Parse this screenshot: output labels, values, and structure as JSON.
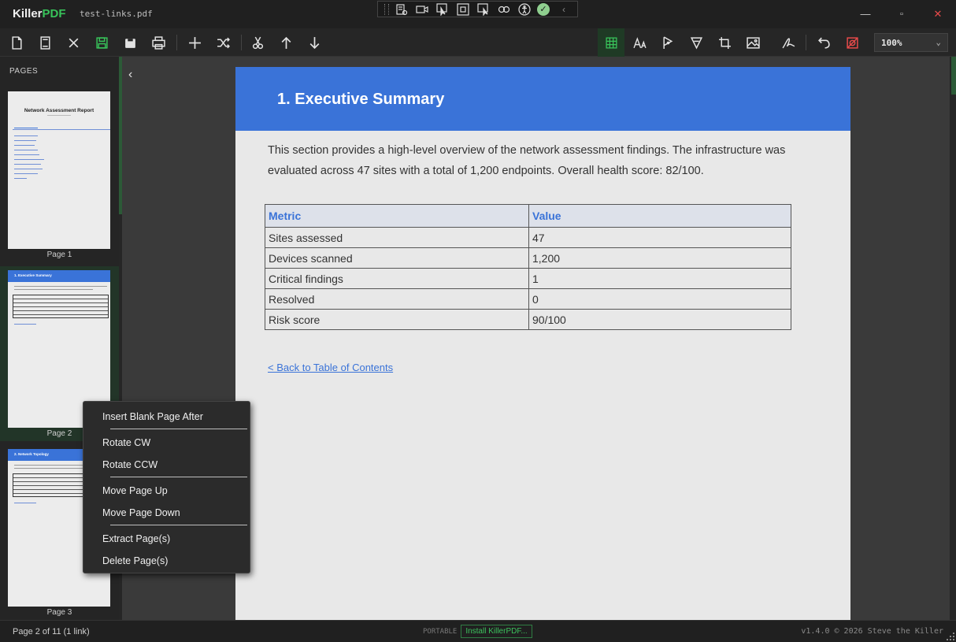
{
  "app": {
    "name_part1": "Killer",
    "name_part2": "PDF",
    "file_name": "test-links.pdf"
  },
  "window_controls": {
    "minimize": "—",
    "maximize": "▫",
    "close": "✕"
  },
  "toolbar": {
    "zoom_value": "100%",
    "icons": [
      "new-page-icon",
      "open-icon",
      "close-icon",
      "save-icon",
      "save-as-icon",
      "print-icon",
      "add-icon",
      "shuffle-icon",
      "cut-icon",
      "move-up-icon",
      "move-down-icon",
      "grid-icon",
      "text-icon",
      "shape-icon",
      "highlight-icon",
      "crop-icon",
      "image-icon",
      "sign-icon",
      "undo-icon",
      "redact-icon"
    ]
  },
  "sidebar": {
    "title": "PAGES",
    "pages": [
      {
        "label": "Page 1",
        "thumb_title": "Network Assessment Report"
      },
      {
        "label": "Page 2",
        "thumb_title": "1. Executive Summary"
      },
      {
        "label": "Page 3",
        "thumb_title": "2. Network Topology"
      }
    ]
  },
  "document": {
    "heading": "1.  Executive Summary",
    "paragraph": "This section provides a high-level overview of the network assessment findings. The infrastructure was evaluated across 47 sites with a total of 1,200 endpoints. Overall health score: 82/100.",
    "table": {
      "headers": [
        "Metric",
        "Value"
      ],
      "rows": [
        [
          "Sites assessed",
          "47"
        ],
        [
          "Devices scanned",
          "1,200"
        ],
        [
          "Critical findings",
          "1"
        ],
        [
          "Resolved",
          "0"
        ],
        [
          "Risk score",
          "90/100"
        ]
      ]
    },
    "back_link": "< Back to Table of Contents"
  },
  "context_menu": {
    "items": [
      "Insert Blank Page After",
      "Rotate CW",
      "Rotate CCW",
      "Move Page Up",
      "Move Page Down",
      "Extract Page(s)",
      "Delete Page(s)"
    ]
  },
  "status": {
    "page_info": "Page 2 of 11  (1 link)",
    "portable": "PORTABLE",
    "install": "Install KillerPDF...",
    "version": "v1.4.0  © 2026  Steve the Killer"
  },
  "colors": {
    "accent_green": "#38c35a",
    "header_blue": "#3a73d8"
  }
}
